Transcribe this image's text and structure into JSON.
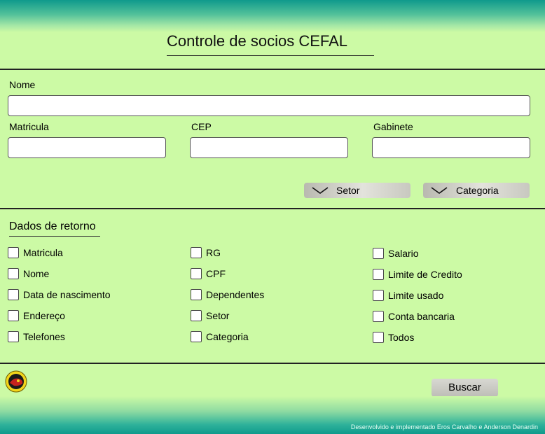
{
  "header": {
    "title": "Controle de socios CEFAL"
  },
  "form": {
    "nome_label": "Nome",
    "nome_value": "",
    "matricula_label": "Matricula",
    "matricula_value": "",
    "cep_label": "CEP",
    "cep_value": "",
    "gabinete_label": "Gabinete",
    "gabinete_value": "",
    "setor_label": "Setor",
    "categoria_label": "Categoria"
  },
  "returns": {
    "title": "Dados de retorno",
    "col1": [
      "Matricula",
      "Nome",
      "Data de nascimento",
      "Endereço",
      "Telefones"
    ],
    "col2": [
      "RG",
      "CPF",
      "Dependentes",
      "Setor",
      "Categoria"
    ],
    "col3": [
      "Salario",
      "Limite de Credito",
      "Limite usado",
      "Conta bancaria",
      "Todos"
    ]
  },
  "actions": {
    "search_label": "Buscar"
  },
  "footer": {
    "credit": "Desenvolvido e implementado Eros Carvalho e Anderson Denardin"
  },
  "icons": {
    "dropdown": "chevron-down-icon",
    "logo": "cefal-logo-icon"
  },
  "colors": {
    "background": "#ccfaa5",
    "band": "#0f9a8c",
    "button": "#c9c9c2"
  }
}
